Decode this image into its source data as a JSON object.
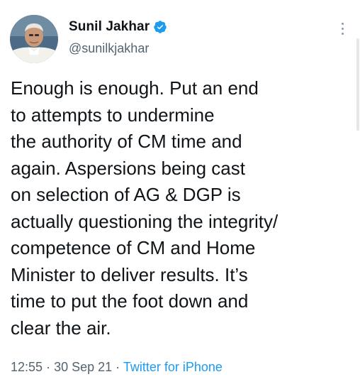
{
  "author": {
    "display_name": "Sunil Jakhar",
    "handle": "@sunilkjakhar",
    "verified": true
  },
  "tweet": {
    "text_lines": [
      "Enough is enough. Put an end",
      "to attempts to undermine",
      "the authority of CM time and",
      "again. Aspersions being cast",
      "on selection of AG & DGP is",
      "actually questioning the integrity/",
      "competence of CM and Home",
      "Minister to deliver results. It’s",
      "time to put the foot down and",
      "clear the air."
    ],
    "time": "12:55",
    "separator": "·",
    "date": "30 Sep 21",
    "source": "Twitter for iPhone"
  },
  "icons": {
    "verified": "verified-badge-icon",
    "more": "more-vertical-icon"
  },
  "colors": {
    "text": "#0f1419",
    "secondary": "#536471",
    "accent": "#1d9bf0"
  }
}
